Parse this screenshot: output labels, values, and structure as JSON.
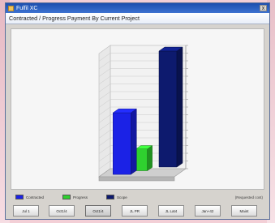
{
  "window": {
    "title": "Fulfil XC",
    "close_label": "x"
  },
  "header": {
    "title": "Contracted / Progress Payment By Current Project"
  },
  "colors": {
    "contracted": "#1b22e6",
    "progress": "#2fd12f",
    "scope": "#0d1a6e"
  },
  "chart_data": {
    "type": "bar",
    "categories": [
      ""
    ],
    "series": [
      {
        "name": "Contracted",
        "values": [
          17
        ]
      },
      {
        "name": "Progress",
        "values": [
          6
        ]
      },
      {
        "name": "Scope",
        "values": [
          32
        ]
      }
    ],
    "ylim": [
      0,
      34
    ]
  },
  "legend": {
    "items": [
      {
        "label": "Contracted",
        "color": "#1b22e6"
      },
      {
        "label": "Progress",
        "color": "#2fd12f"
      },
      {
        "label": "Scope",
        "color": "#0d1a6e"
      }
    ],
    "note": "(Requested cost)"
  },
  "buttons": [
    {
      "label": "Jul 1"
    },
    {
      "label": "Oct1/4"
    },
    {
      "label": "Oct1/4"
    },
    {
      "label": "JL PR"
    },
    {
      "label": "JL Lat4"
    },
    {
      "label": "Jan+42"
    },
    {
      "label": "Maint"
    }
  ]
}
